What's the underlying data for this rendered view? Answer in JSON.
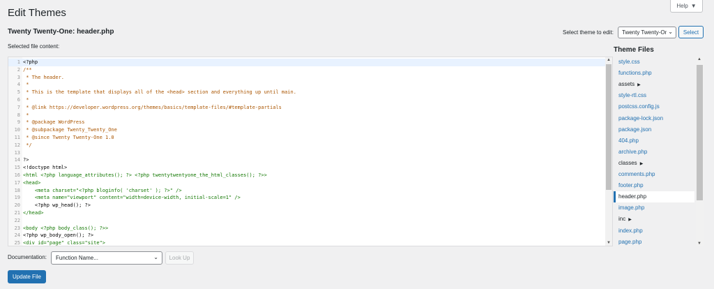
{
  "header": {
    "help_label": "Help",
    "help_icon": "caret-down-icon",
    "page_title": "Edit Themes",
    "file_heading": "Twenty Twenty-One: header.php",
    "select_theme_label": "Select theme to edit:",
    "select_theme_value": "Twenty Twenty-One",
    "select_button": "Select"
  },
  "editor": {
    "label": "Selected file content:",
    "lines": [
      {
        "n": "1",
        "text": "<?php",
        "color": "#000000"
      },
      {
        "n": "2",
        "text": "/**",
        "color": "#aa5500"
      },
      {
        "n": "3",
        "text": " * The header.",
        "color": "#aa5500"
      },
      {
        "n": "4",
        "text": " *",
        "color": "#aa5500"
      },
      {
        "n": "5",
        "text": " * This is the template that displays all of the <head> section and everything up until main.",
        "color": "#aa5500"
      },
      {
        "n": "6",
        "text": " *",
        "color": "#aa5500"
      },
      {
        "n": "7",
        "text": " * @link https://developer.wordpress.org/themes/basics/template-files/#template-partials",
        "color": "#aa5500"
      },
      {
        "n": "8",
        "text": " *",
        "color": "#aa5500"
      },
      {
        "n": "9",
        "text": " * @package WordPress",
        "color": "#aa5500"
      },
      {
        "n": "10",
        "text": " * @subpackage Twenty_Twenty_One",
        "color": "#aa5500"
      },
      {
        "n": "11",
        "text": " * @since Twenty Twenty-One 1.0",
        "color": "#aa5500"
      },
      {
        "n": "12",
        "text": " */",
        "color": "#aa5500"
      },
      {
        "n": "13",
        "text": "",
        "color": "#000000"
      },
      {
        "n": "14",
        "text": "?>",
        "color": "#000000"
      },
      {
        "n": "15",
        "text": "<!doctype html>",
        "color": "#000000"
      },
      {
        "n": "16",
        "text": "<html <?php language_attributes(); ?> <?php twentytwentyone_the_html_classes(); ?>>",
        "color": "#117700"
      },
      {
        "n": "17",
        "text": "<head>",
        "color": "#117700"
      },
      {
        "n": "18",
        "text": "    <meta charset=\"<?php bloginfo( 'charset' ); ?>\" />",
        "color": "#117700"
      },
      {
        "n": "19",
        "text": "    <meta name=\"viewport\" content=\"width=device-width, initial-scale=1\" />",
        "color": "#117700"
      },
      {
        "n": "20",
        "text": "    <?php wp_head(); ?>",
        "color": "#000000"
      },
      {
        "n": "21",
        "text": "</head>",
        "color": "#117700"
      },
      {
        "n": "22",
        "text": "",
        "color": "#000000"
      },
      {
        "n": "23",
        "text": "<body <?php body_class(); ?>>",
        "color": "#117700"
      },
      {
        "n": "24",
        "text": "<?php wp_body_open(); ?>",
        "color": "#000000"
      },
      {
        "n": "25",
        "text": "<div id=\"page\" class=\"site\">",
        "color": "#117700"
      }
    ]
  },
  "sidebar": {
    "heading": "Theme Files",
    "files": [
      {
        "label": "style.css",
        "type": "file"
      },
      {
        "label": "functions.php",
        "type": "file"
      },
      {
        "label": "assets",
        "type": "folder"
      },
      {
        "label": "style-rtl.css",
        "type": "file"
      },
      {
        "label": "postcss.config.js",
        "type": "file"
      },
      {
        "label": "package-lock.json",
        "type": "file"
      },
      {
        "label": "package.json",
        "type": "file"
      },
      {
        "label": "404.php",
        "type": "file"
      },
      {
        "label": "archive.php",
        "type": "file"
      },
      {
        "label": "classes",
        "type": "folder"
      },
      {
        "label": "comments.php",
        "type": "file"
      },
      {
        "label": "footer.php",
        "type": "file"
      },
      {
        "label": "header.php",
        "type": "current"
      },
      {
        "label": "image.php",
        "type": "file"
      },
      {
        "label": "inc",
        "type": "folder"
      },
      {
        "label": "index.php",
        "type": "file"
      },
      {
        "label": "page.php",
        "type": "file"
      }
    ]
  },
  "footer": {
    "documentation_label": "Documentation:",
    "function_placeholder": "Function Name...",
    "lookup_button": "Look Up",
    "update_button": "Update File"
  },
  "colors": {
    "accent": "#2271b1",
    "comment": "#aa5500",
    "tag": "#117700"
  }
}
